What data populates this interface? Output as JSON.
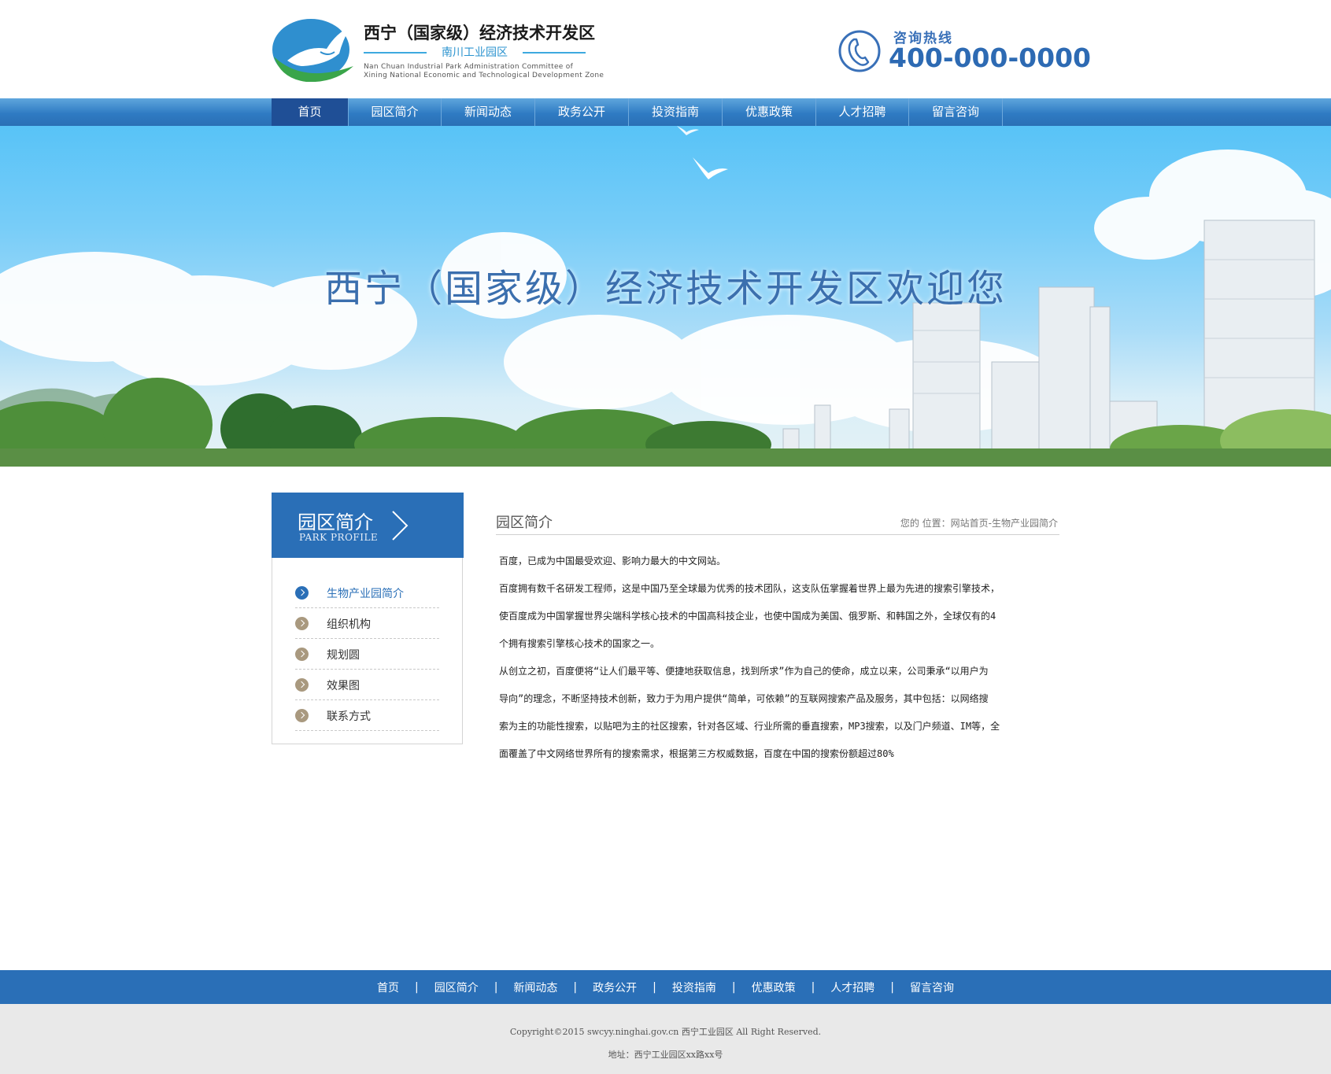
{
  "header": {
    "logo_title": "西宁（国家级）经济技术开发区",
    "logo_subtitle": "南川工业园区",
    "logo_en_line1": "Nan Chuan Industrial Park Administration Committee of",
    "logo_en_line2": "Xining National Economic and Technological Development Zone",
    "hotline_label": "咨询热线",
    "hotline_number": "400-000-0000"
  },
  "nav": {
    "items": [
      {
        "label": "首页"
      },
      {
        "label": "园区简介"
      },
      {
        "label": "新闻动态"
      },
      {
        "label": "政务公开"
      },
      {
        "label": "投资指南"
      },
      {
        "label": "优惠政策"
      },
      {
        "label": "人才招聘"
      },
      {
        "label": "留言咨询"
      }
    ],
    "active_index": 0
  },
  "banner": {
    "title": "西宁（国家级）经济技术开发区欢迎您"
  },
  "sidebar": {
    "title": "园区简介",
    "title_en": "PARK PROFILE",
    "items": [
      {
        "label": "生物产业园简介"
      },
      {
        "label": "组织机构"
      },
      {
        "label": "规划圆"
      },
      {
        "label": "效果图"
      },
      {
        "label": "联系方式"
      }
    ],
    "active_index": 0
  },
  "main": {
    "title": "园区简介",
    "breadcrumb": "您的 位置：网站首页-生物产业园简介",
    "paragraphs": [
      "百度，已成为中国最受欢迎、影响力最大的中文网站。",
      "百度拥有数千名研发工程师，这是中国乃至全球最为优秀的技术团队，这支队伍掌握着世界上最为先进的搜索引擎技术，",
      "使百度成为中国掌握世界尖端科学核心技术的中国高科技企业，也使中国成为美国、俄罗斯、和韩国之外，全球仅有的4",
      "个拥有搜索引擎核心技术的国家之一。",
      "从创立之初，百度便将“让人们最平等、便捷地获取信息，找到所求”作为自己的使命，成立以来，公司秉承“以用户为",
      "导向”的理念，不断坚持技术创新，致力于为用户提供“简单，可依赖”的互联网搜索产品及服务，其中包括：以网络搜",
      "索为主的功能性搜索，以贴吧为主的社区搜索，针对各区域、行业所需的垂直搜索，MP3搜索，以及门户频道、IM等，全",
      "面覆盖了中文网络世界所有的搜索需求，根据第三方权威数据，百度在中国的搜索份额超过80%"
    ]
  },
  "footer": {
    "nav_items": [
      {
        "label": "首页"
      },
      {
        "label": "园区简介"
      },
      {
        "label": "新闻动态"
      },
      {
        "label": "政务公开"
      },
      {
        "label": "投资指南"
      },
      {
        "label": "优惠政策"
      },
      {
        "label": "人才招聘"
      },
      {
        "label": "留言咨询"
      }
    ],
    "separator": "|",
    "copyright": "Copyright©2015 swcyy.ninghai.gov.cn   西宁工业园区 All Right Reserved.",
    "address": "地址：西宁工业园区xx路xx号"
  },
  "colors": {
    "brand_blue": "#2a6fb7",
    "nav_active": "#1f4f96",
    "footer_gray": "#e9e9e9"
  }
}
